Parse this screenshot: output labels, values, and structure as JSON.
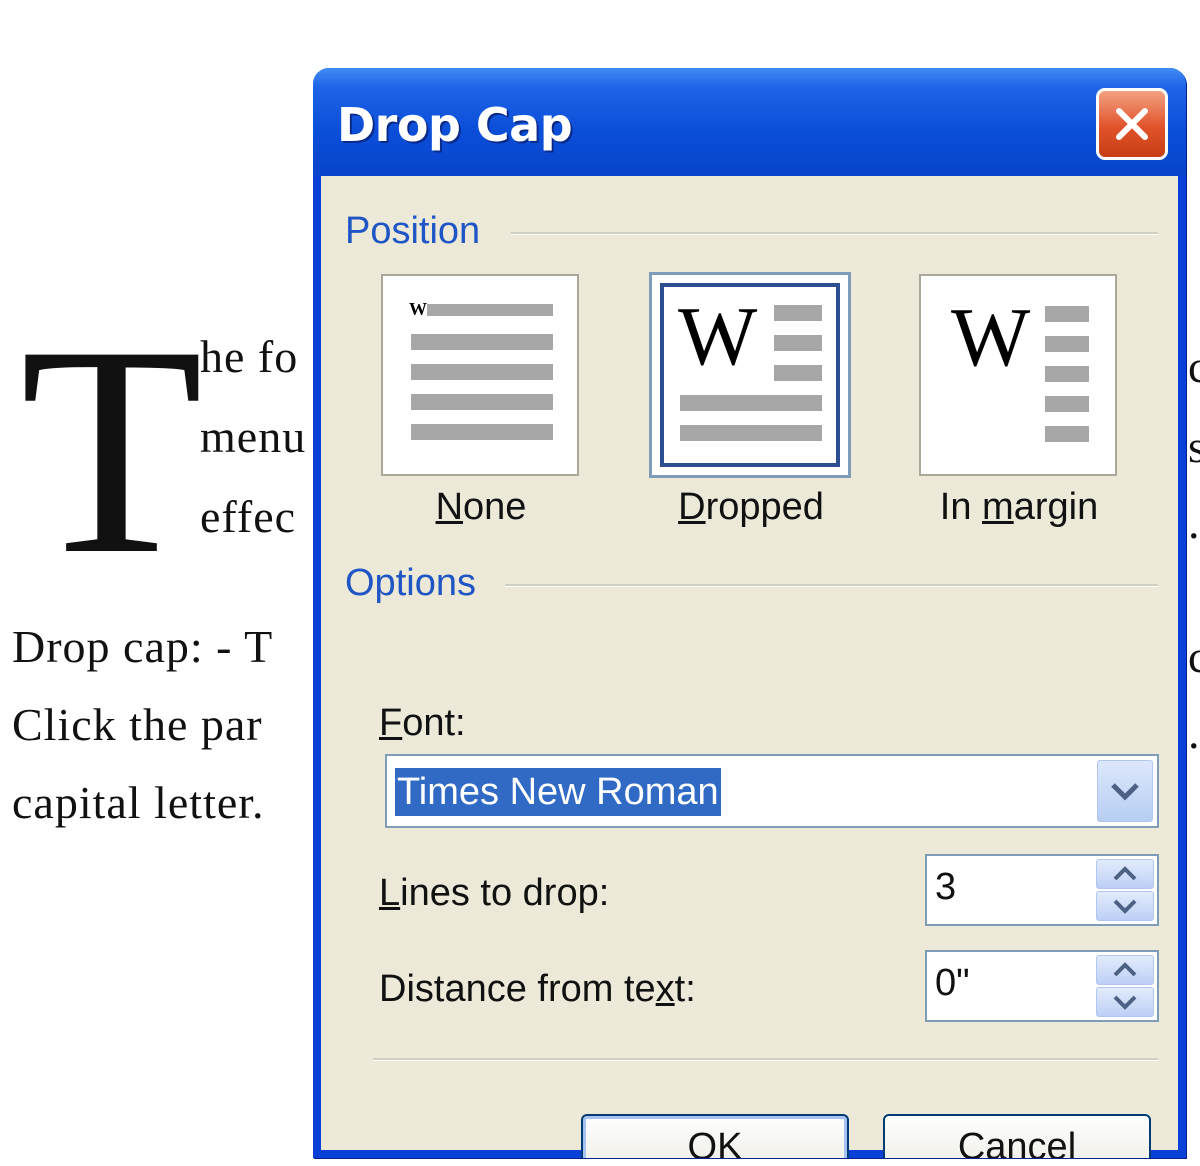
{
  "document": {
    "drop_letter": "T",
    "lines": [
      "he fo",
      "menu",
      "effec"
    ],
    "para2": [
      "Drop cap: - T",
      "Click the par",
      "capital letter."
    ],
    "right_edge_fragments": [
      "c",
      "s",
      ".",
      "c",
      "."
    ]
  },
  "dialog": {
    "title": "Drop Cap",
    "close_icon": "close-icon",
    "position": {
      "group_label": "Position",
      "options": [
        {
          "label": "None",
          "mnemonic": "N",
          "rest": "one",
          "preview_letter": "W",
          "selected": false
        },
        {
          "label": "Dropped",
          "mnemonic": "D",
          "rest": "ropped",
          "preview_letter": "W",
          "selected": true
        },
        {
          "label": "In margin",
          "pre": "In ",
          "mnemonic": "m",
          "rest": "argin",
          "preview_letter": "W",
          "selected": false
        }
      ]
    },
    "options": {
      "group_label": "Options",
      "font": {
        "label_mnemonic": "F",
        "label_rest": "ont:",
        "value": "Times New Roman"
      },
      "lines_to_drop": {
        "label_mnemonic": "L",
        "label_rest": "ines to drop:",
        "value": "3"
      },
      "distance": {
        "label_pre": "Distance from te",
        "label_mnemonic": "x",
        "label_rest": "t:",
        "value": "0\""
      }
    },
    "buttons": {
      "ok": "OK",
      "cancel": "Cancel"
    },
    "colors": {
      "titlebar": "#0a4ed8",
      "client": "#ece9d8",
      "group_label": "#1f55c4",
      "selection": "#316ac5"
    }
  }
}
